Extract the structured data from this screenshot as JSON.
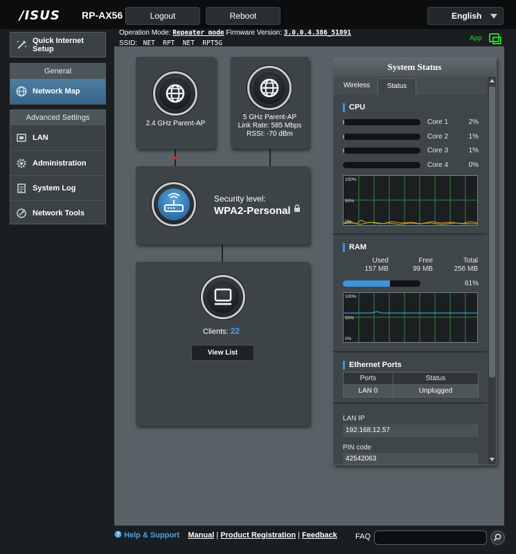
{
  "header": {
    "brand": "/ISUS",
    "model": "RP-AX56",
    "logout_label": "Logout",
    "reboot_label": "Reboot",
    "language": "English"
  },
  "info": {
    "op_mode_label": "Operation Mode:",
    "op_mode_value": "Repeater mode",
    "firmware_label": "Firmware Version:",
    "firmware_value": "3.0.0.4.386_51891",
    "ssid_label": "SSID:",
    "ssid_values": "_NET__RPT  _NET__RPT5G",
    "app_label": "App"
  },
  "sidebar": {
    "quick_setup": "Quick Internet Setup",
    "general_title": "General",
    "network_map": "Network Map",
    "advanced_title": "Advanced Settings",
    "items": [
      {
        "label": "LAN"
      },
      {
        "label": "Administration"
      },
      {
        "label": "System Log"
      },
      {
        "label": "Network Tools"
      }
    ]
  },
  "network_map": {
    "parent_24": "2.4 GHz Parent-AP",
    "parent_5": "5 GHz Parent-AP",
    "link_rate": "Link Rate: 585 Mbps",
    "rssi": "RSSI: -70 dBm",
    "security_label": "Security level:",
    "security_value": "WPA2-Personal",
    "clients_label": "Clients:",
    "clients_count": "22",
    "view_list": "View List"
  },
  "system_status": {
    "title": "System Status",
    "tabs": [
      "Wireless",
      "Status"
    ],
    "active_tab": "Status",
    "cpu": {
      "title": "CPU",
      "cores": [
        {
          "label": "Core 1",
          "pct": "2%",
          "value": 0.02
        },
        {
          "label": "Core 2",
          "pct": "1%",
          "value": 0.01
        },
        {
          "label": "Core 3",
          "pct": "1%",
          "value": 0.01
        },
        {
          "label": "Core 4",
          "pct": "0%",
          "value": 0.0
        }
      ],
      "graph_labels": [
        "100%",
        "50%",
        "0%"
      ]
    },
    "ram": {
      "title": "RAM",
      "used_label": "Used",
      "used": "157 MB",
      "free_label": "Free",
      "free": "99 MB",
      "total_label": "Total",
      "total": "256 MB",
      "pct": "61%",
      "value": 0.61,
      "graph_labels": [
        "100%",
        "50%",
        "0%"
      ]
    },
    "ethernet": {
      "title": "Ethernet Ports",
      "headers": [
        "Ports",
        "Status"
      ],
      "rows": [
        [
          "LAN 0",
          "Unplugged"
        ]
      ]
    },
    "lan_ip_label": "LAN IP",
    "lan_ip": "192.168.12.57",
    "pin_label": "PIN code",
    "pin": "42542063"
  },
  "footer": {
    "help": "Help & Support",
    "manual": "Manual",
    "product_registration": "Product Registration",
    "feedback": "Feedback",
    "faq": "FAQ"
  },
  "colors": {
    "accent": "#3d92e0",
    "cpu_bar": "#e79925",
    "ram_bar": "#3a94e2",
    "app_green": "#22d322",
    "clients_count": "#4ca3e9",
    "disconnected": "#d0312d"
  },
  "icons": [
    "globe-icon",
    "router-icon",
    "monitor-icon",
    "lock-icon",
    "search-icon",
    "app-icon"
  ]
}
